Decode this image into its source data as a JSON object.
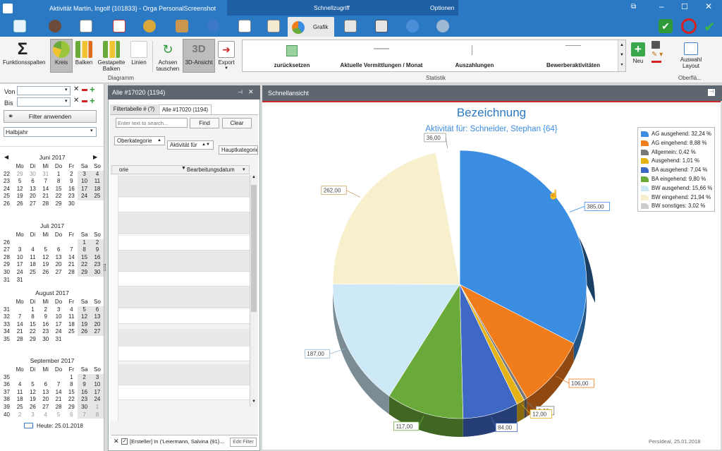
{
  "window": {
    "title": "Aktivität Martin, Ingolf {101833} - Orga PersonalScreenshot",
    "quickaccess": "Schnellzugriff",
    "options": "Optionen"
  },
  "grafik_tab": "Grafik",
  "ribbon": {
    "funktionsspalten": "Funktionsspalten",
    "kreis": "Kreis",
    "balken": "Balken",
    "gestapelte_1": "Gestapelte",
    "gestapelte_2": "Balken",
    "linien": "Linien",
    "achsen_1": "Achsen",
    "achsen_2": "tauschen",
    "dreid": "3D-Ansicht",
    "export": "Export",
    "group_diagramm": "Diagramm",
    "group_statistik": "Statistik",
    "group_oberflaeche": "Oberflä...",
    "stat_items": [
      "zurücksetzen",
      "Aktuelle Vermittlungen / Monat",
      "Auszahlungen",
      "Bewerberaktivitäten"
    ],
    "neu": "Neu",
    "auswahl_1": "Auswahl",
    "auswahl_2": "Layout"
  },
  "left": {
    "von_label": "Von",
    "bis_label": "Bis",
    "filter_button": "Filter anwenden",
    "period": "Halbjahr",
    "today": "Heute: 25.01.2018",
    "weekday_headers": [
      "Mo",
      "Di",
      "Mi",
      "Do",
      "Fr",
      "Sa",
      "So"
    ],
    "months": [
      {
        "title": "Juni 2017",
        "weeks": [
          [
            "22",
            "29",
            "30",
            "31",
            "1",
            "2",
            "3",
            "4"
          ],
          [
            "23",
            "5",
            "6",
            "7",
            "8",
            "9",
            "10",
            "11"
          ],
          [
            "24",
            "12",
            "13",
            "14",
            "15",
            "16",
            "17",
            "18"
          ],
          [
            "25",
            "19",
            "20",
            "21",
            "22",
            "23",
            "24",
            "25"
          ],
          [
            "26",
            "26",
            "27",
            "28",
            "29",
            "30",
            "",
            ""
          ]
        ]
      },
      {
        "title": "Juli 2017",
        "weeks": [
          [
            "26",
            "",
            "",
            "",
            "",
            "",
            "1",
            "2"
          ],
          [
            "27",
            "3",
            "4",
            "5",
            "6",
            "7",
            "8",
            "9"
          ],
          [
            "28",
            "10",
            "11",
            "12",
            "13",
            "14",
            "15",
            "16"
          ],
          [
            "29",
            "17",
            "18",
            "19",
            "20",
            "21",
            "22",
            "23"
          ],
          [
            "30",
            "24",
            "25",
            "26",
            "27",
            "28",
            "29",
            "30"
          ],
          [
            "31",
            "31",
            "",
            "",
            "",
            "",
            "",
            ""
          ]
        ]
      },
      {
        "title": "August 2017",
        "weeks": [
          [
            "31",
            "",
            "1",
            "2",
            "3",
            "4",
            "5",
            "6"
          ],
          [
            "32",
            "7",
            "8",
            "9",
            "10",
            "11",
            "12",
            "13"
          ],
          [
            "33",
            "14",
            "15",
            "16",
            "17",
            "18",
            "19",
            "20"
          ],
          [
            "34",
            "21",
            "22",
            "23",
            "24",
            "25",
            "26",
            "27"
          ],
          [
            "35",
            "28",
            "29",
            "30",
            "31",
            "",
            "",
            ""
          ]
        ]
      },
      {
        "title": "September 2017",
        "weeks": [
          [
            "35",
            "",
            "",
            "",
            "",
            "1",
            "2",
            "3"
          ],
          [
            "36",
            "4",
            "5",
            "6",
            "7",
            "8",
            "9",
            "10"
          ],
          [
            "37",
            "11",
            "12",
            "13",
            "14",
            "15",
            "16",
            "17"
          ],
          [
            "38",
            "18",
            "19",
            "20",
            "21",
            "22",
            "23",
            "24"
          ],
          [
            "39",
            "25",
            "26",
            "27",
            "28",
            "29",
            "30",
            "1"
          ],
          [
            "40",
            "2",
            "3",
            "4",
            "5",
            "6",
            "7",
            "8"
          ]
        ]
      }
    ]
  },
  "middle": {
    "header": "Alle #17020 (1194)",
    "tab_filter": "Filtertabelle # (?)",
    "tab_all": "Alle #17020 (1194)",
    "search_placeholder": "Enter text to search...",
    "find": "Find",
    "clear": "Clear",
    "group_oberkategorie": "Oberkategorie",
    "group_aktivitaet": "Aktivität für",
    "group_hauptkategorie": "Hauptkategorie",
    "col_1": "orie",
    "col_2": "Bearbeitungsdatum",
    "filter_text": "[Ersteller] In ('Leiermann, Salvina {91}...",
    "edit_filter": "Edit Filter"
  },
  "right": {
    "header": "Schnellansicht",
    "footer": "PersIdeal, 25.01.2018"
  },
  "chart_data": {
    "type": "pie",
    "title": "Bezeichnung",
    "subtitle": "Aktivität für: Schneider, Stephan {64}",
    "legend_position": "top-right",
    "slices": [
      {
        "label": "AG ausgehend: 32,24 %",
        "value": 385,
        "value_label": "385,00",
        "color": "#3a8de0"
      },
      {
        "label": "AG eingehend: 8,88 %",
        "value": 106,
        "value_label": "106,00",
        "color": "#f07c1c"
      },
      {
        "label": "Allgemein: 0,42 %",
        "value": 5,
        "value_label": "5,00",
        "color": "#777777"
      },
      {
        "label": "Ausgehend: 1,01 %",
        "value": 12,
        "value_label": "12,00",
        "color": "#e6b317"
      },
      {
        "label": "BA ausgehend: 7,04 %",
        "value": 84,
        "value_label": "84,00",
        "color": "#3f68c4"
      },
      {
        "label": "BA eingehend: 9,80 %",
        "value": 117,
        "value_label": "117,00",
        "color": "#6aaa3b"
      },
      {
        "label": "BW ausgehend: 15,66 %",
        "value": 187,
        "value_label": "187,00",
        "color": "#cde9f7"
      },
      {
        "label": "BW eingehend: 21,94 %",
        "value": 262,
        "value_label": "262,00",
        "color": "#f8f0cc"
      },
      {
        "label": "BW sonstiges: 3,02 %",
        "value": 36,
        "value_label": "36,00",
        "color": "#ffffff"
      }
    ]
  }
}
